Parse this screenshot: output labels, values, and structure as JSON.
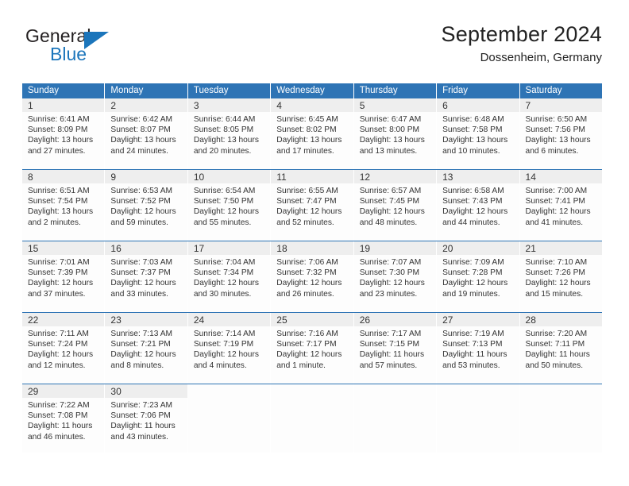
{
  "brand": {
    "name_part1": "General",
    "name_part2": "Blue",
    "triangle_color": "#1b75bb"
  },
  "header": {
    "title": "September 2024",
    "subtitle": "Dossenheim, Germany"
  },
  "theme": {
    "header_blue": "#2e74b5",
    "daynum_background": "#eeeeee",
    "text_color": "#333333"
  },
  "weekdays": [
    "Sunday",
    "Monday",
    "Tuesday",
    "Wednesday",
    "Thursday",
    "Friday",
    "Saturday"
  ],
  "weeks": [
    [
      {
        "day": "1",
        "sunrise": "Sunrise: 6:41 AM",
        "sunset": "Sunset: 8:09 PM",
        "daylight1": "Daylight: 13 hours",
        "daylight2": "and 27 minutes."
      },
      {
        "day": "2",
        "sunrise": "Sunrise: 6:42 AM",
        "sunset": "Sunset: 8:07 PM",
        "daylight1": "Daylight: 13 hours",
        "daylight2": "and 24 minutes."
      },
      {
        "day": "3",
        "sunrise": "Sunrise: 6:44 AM",
        "sunset": "Sunset: 8:05 PM",
        "daylight1": "Daylight: 13 hours",
        "daylight2": "and 20 minutes."
      },
      {
        "day": "4",
        "sunrise": "Sunrise: 6:45 AM",
        "sunset": "Sunset: 8:02 PM",
        "daylight1": "Daylight: 13 hours",
        "daylight2": "and 17 minutes."
      },
      {
        "day": "5",
        "sunrise": "Sunrise: 6:47 AM",
        "sunset": "Sunset: 8:00 PM",
        "daylight1": "Daylight: 13 hours",
        "daylight2": "and 13 minutes."
      },
      {
        "day": "6",
        "sunrise": "Sunrise: 6:48 AM",
        "sunset": "Sunset: 7:58 PM",
        "daylight1": "Daylight: 13 hours",
        "daylight2": "and 10 minutes."
      },
      {
        "day": "7",
        "sunrise": "Sunrise: 6:50 AM",
        "sunset": "Sunset: 7:56 PM",
        "daylight1": "Daylight: 13 hours",
        "daylight2": "and 6 minutes."
      }
    ],
    [
      {
        "day": "8",
        "sunrise": "Sunrise: 6:51 AM",
        "sunset": "Sunset: 7:54 PM",
        "daylight1": "Daylight: 13 hours",
        "daylight2": "and 2 minutes."
      },
      {
        "day": "9",
        "sunrise": "Sunrise: 6:53 AM",
        "sunset": "Sunset: 7:52 PM",
        "daylight1": "Daylight: 12 hours",
        "daylight2": "and 59 minutes."
      },
      {
        "day": "10",
        "sunrise": "Sunrise: 6:54 AM",
        "sunset": "Sunset: 7:50 PM",
        "daylight1": "Daylight: 12 hours",
        "daylight2": "and 55 minutes."
      },
      {
        "day": "11",
        "sunrise": "Sunrise: 6:55 AM",
        "sunset": "Sunset: 7:47 PM",
        "daylight1": "Daylight: 12 hours",
        "daylight2": "and 52 minutes."
      },
      {
        "day": "12",
        "sunrise": "Sunrise: 6:57 AM",
        "sunset": "Sunset: 7:45 PM",
        "daylight1": "Daylight: 12 hours",
        "daylight2": "and 48 minutes."
      },
      {
        "day": "13",
        "sunrise": "Sunrise: 6:58 AM",
        "sunset": "Sunset: 7:43 PM",
        "daylight1": "Daylight: 12 hours",
        "daylight2": "and 44 minutes."
      },
      {
        "day": "14",
        "sunrise": "Sunrise: 7:00 AM",
        "sunset": "Sunset: 7:41 PM",
        "daylight1": "Daylight: 12 hours",
        "daylight2": "and 41 minutes."
      }
    ],
    [
      {
        "day": "15",
        "sunrise": "Sunrise: 7:01 AM",
        "sunset": "Sunset: 7:39 PM",
        "daylight1": "Daylight: 12 hours",
        "daylight2": "and 37 minutes."
      },
      {
        "day": "16",
        "sunrise": "Sunrise: 7:03 AM",
        "sunset": "Sunset: 7:37 PM",
        "daylight1": "Daylight: 12 hours",
        "daylight2": "and 33 minutes."
      },
      {
        "day": "17",
        "sunrise": "Sunrise: 7:04 AM",
        "sunset": "Sunset: 7:34 PM",
        "daylight1": "Daylight: 12 hours",
        "daylight2": "and 30 minutes."
      },
      {
        "day": "18",
        "sunrise": "Sunrise: 7:06 AM",
        "sunset": "Sunset: 7:32 PM",
        "daylight1": "Daylight: 12 hours",
        "daylight2": "and 26 minutes."
      },
      {
        "day": "19",
        "sunrise": "Sunrise: 7:07 AM",
        "sunset": "Sunset: 7:30 PM",
        "daylight1": "Daylight: 12 hours",
        "daylight2": "and 23 minutes."
      },
      {
        "day": "20",
        "sunrise": "Sunrise: 7:09 AM",
        "sunset": "Sunset: 7:28 PM",
        "daylight1": "Daylight: 12 hours",
        "daylight2": "and 19 minutes."
      },
      {
        "day": "21",
        "sunrise": "Sunrise: 7:10 AM",
        "sunset": "Sunset: 7:26 PM",
        "daylight1": "Daylight: 12 hours",
        "daylight2": "and 15 minutes."
      }
    ],
    [
      {
        "day": "22",
        "sunrise": "Sunrise: 7:11 AM",
        "sunset": "Sunset: 7:24 PM",
        "daylight1": "Daylight: 12 hours",
        "daylight2": "and 12 minutes."
      },
      {
        "day": "23",
        "sunrise": "Sunrise: 7:13 AM",
        "sunset": "Sunset: 7:21 PM",
        "daylight1": "Daylight: 12 hours",
        "daylight2": "and 8 minutes."
      },
      {
        "day": "24",
        "sunrise": "Sunrise: 7:14 AM",
        "sunset": "Sunset: 7:19 PM",
        "daylight1": "Daylight: 12 hours",
        "daylight2": "and 4 minutes."
      },
      {
        "day": "25",
        "sunrise": "Sunrise: 7:16 AM",
        "sunset": "Sunset: 7:17 PM",
        "daylight1": "Daylight: 12 hours",
        "daylight2": "and 1 minute."
      },
      {
        "day": "26",
        "sunrise": "Sunrise: 7:17 AM",
        "sunset": "Sunset: 7:15 PM",
        "daylight1": "Daylight: 11 hours",
        "daylight2": "and 57 minutes."
      },
      {
        "day": "27",
        "sunrise": "Sunrise: 7:19 AM",
        "sunset": "Sunset: 7:13 PM",
        "daylight1": "Daylight: 11 hours",
        "daylight2": "and 53 minutes."
      },
      {
        "day": "28",
        "sunrise": "Sunrise: 7:20 AM",
        "sunset": "Sunset: 7:11 PM",
        "daylight1": "Daylight: 11 hours",
        "daylight2": "and 50 minutes."
      }
    ],
    [
      {
        "day": "29",
        "sunrise": "Sunrise: 7:22 AM",
        "sunset": "Sunset: 7:08 PM",
        "daylight1": "Daylight: 11 hours",
        "daylight2": "and 46 minutes."
      },
      {
        "day": "30",
        "sunrise": "Sunrise: 7:23 AM",
        "sunset": "Sunset: 7:06 PM",
        "daylight1": "Daylight: 11 hours",
        "daylight2": "and 43 minutes."
      },
      {
        "day": "",
        "sunrise": "",
        "sunset": "",
        "daylight1": "",
        "daylight2": ""
      },
      {
        "day": "",
        "sunrise": "",
        "sunset": "",
        "daylight1": "",
        "daylight2": ""
      },
      {
        "day": "",
        "sunrise": "",
        "sunset": "",
        "daylight1": "",
        "daylight2": ""
      },
      {
        "day": "",
        "sunrise": "",
        "sunset": "",
        "daylight1": "",
        "daylight2": ""
      },
      {
        "day": "",
        "sunrise": "",
        "sunset": "",
        "daylight1": "",
        "daylight2": ""
      }
    ]
  ]
}
